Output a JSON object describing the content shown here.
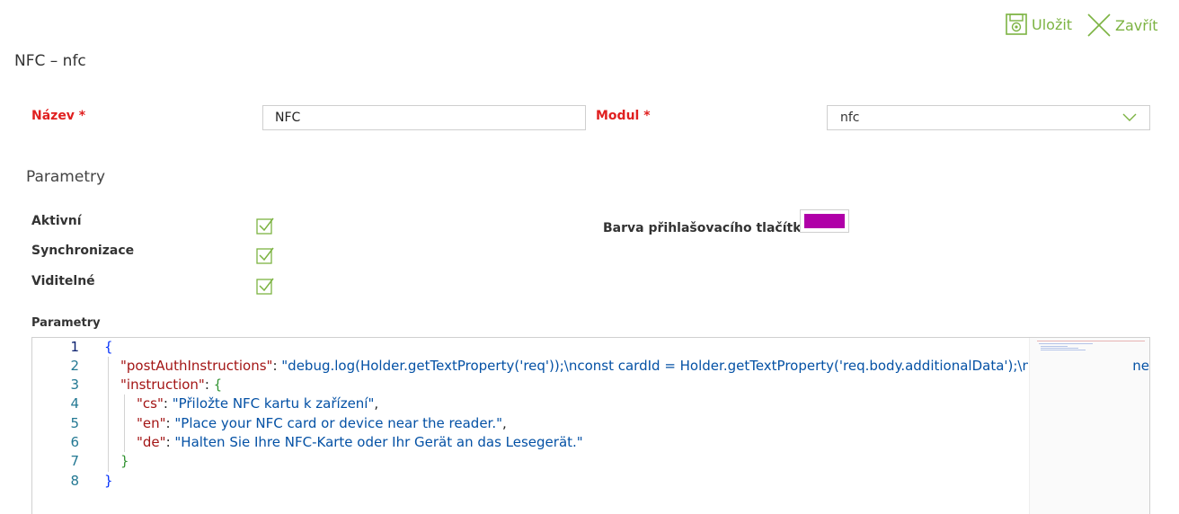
{
  "toolbar": {
    "save_label": "Uložit",
    "close_label": "Zavřít",
    "accent_color": "#7cb342"
  },
  "page": {
    "title": "NFC – nfc"
  },
  "form": {
    "name_label": "Název *",
    "name_value": "NFC",
    "module_label": "Modul *",
    "module_value": "nfc"
  },
  "params": {
    "section_title": "Parametry",
    "active_label": "Aktivní",
    "active_checked": true,
    "sync_label": "Synchronizace",
    "sync_checked": true,
    "visible_label": "Viditelné",
    "visible_checked": true,
    "button_color_label": "Barva přihlašovacího tlačítka",
    "button_color": "#b000a8",
    "editor_label": "Parametry"
  },
  "editor": {
    "line_numbers": [
      "1",
      "2",
      "3",
      "4",
      "5",
      "6",
      "7",
      "8"
    ],
    "line2_key": "\"postAuthInstructions\"",
    "line2_value": "\"debug.log(Holder.getTextProperty('req'));\\nconst cardId = Holder.getTextProperty('req.body.additionalData');\\nc",
    "line2_tail": "ne",
    "line3_key": "\"instruction\"",
    "line4_key": "\"cs\"",
    "line4_value": "\"Přiložte NFC kartu k zařízení\"",
    "line5_key": "\"en\"",
    "line5_value": "\"Place your NFC card or device near the reader.\"",
    "line6_key": "\"de\"",
    "line6_value": "\"Halten Sie Ihre NFC-Karte oder Ihr Gerät an das Lesegerät.\""
  }
}
